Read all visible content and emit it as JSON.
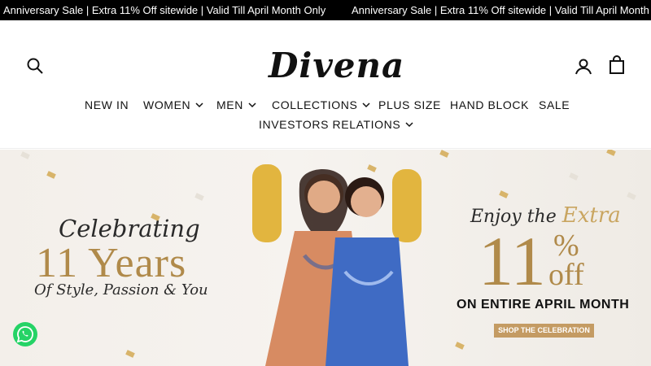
{
  "announcement": {
    "text_1": "Anniversary Sale | Extra 11% Off sitewide | Valid Till April Month Only",
    "text_2": "Anniversary Sale | Extra 11% Off sitewide | Valid Till April Month"
  },
  "header": {
    "logo": "Divena",
    "icons": [
      "search-icon",
      "account-icon",
      "cart-icon"
    ]
  },
  "nav": {
    "items": [
      {
        "label": "NEW IN",
        "dropdown": false
      },
      {
        "label": "WOMEN",
        "dropdown": true
      },
      {
        "label": "MEN",
        "dropdown": true
      },
      {
        "label": "COLLECTIONS",
        "dropdown": true
      },
      {
        "label": "PLUS SIZE",
        "dropdown": false
      },
      {
        "label": "HAND BLOCK",
        "dropdown": false
      },
      {
        "label": "SALE",
        "dropdown": false
      },
      {
        "label": "INVESTORS RELATIONS",
        "dropdown": true
      }
    ]
  },
  "hero": {
    "celebrating": "Celebrating",
    "years": "11 Years",
    "tagline": "Of Style, Passion & You",
    "enjoy_the": "Enjoy the",
    "extra": "Extra",
    "percent": "11",
    "percent_sign": "%",
    "off": "off",
    "entire": "ON ENTIRE APRIL MONTH",
    "cta": "SHOP THE CELEBRATION",
    "balloon": "1"
  },
  "colors": {
    "gold": "#b08a4a",
    "cta": "#c49b63",
    "announcement_bg": "#000000",
    "whatsapp": "#25d366"
  }
}
